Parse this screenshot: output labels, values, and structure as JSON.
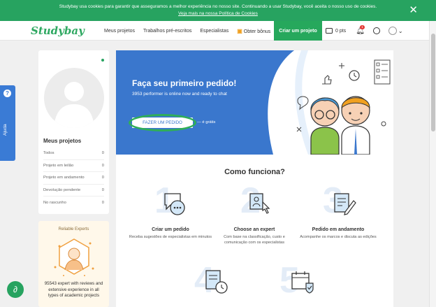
{
  "cookie": {
    "text": "Studybay usa cookies para garantir que asseguramos a melhor experiência no nosso site. Continuando a usar Studybay, você aceita o nosso uso de cookies.",
    "link": "Veja mais na nossa Política de Cookies",
    "close": "✕"
  },
  "header": {
    "logo": "Studybay",
    "nav": [
      "Meus projetos",
      "Trabalhos pré-escritos",
      "Especialistas",
      "Obter bônus"
    ],
    "cta": "Criar um projeto",
    "points": "0 pts",
    "badge": "1"
  },
  "help": {
    "label": "Ajuda",
    "icon": "?"
  },
  "profile": {
    "projects_title": "Meus projetos",
    "items": [
      {
        "label": "Todos",
        "count": "0"
      },
      {
        "label": "Projeto em leilão",
        "count": "0"
      },
      {
        "label": "Projeto em andamento",
        "count": "0"
      },
      {
        "label": "Devolução pendente",
        "count": "0"
      },
      {
        "label": "No rascunho",
        "count": "0"
      }
    ]
  },
  "experts": {
    "title": "Reliable Experts",
    "text": "95543 expert with reviews and extensive experience in all types of academic projects"
  },
  "hero": {
    "title": "Faça seu primeiro pedido!",
    "subtitle": "3953 performer is online now and ready to chat",
    "button": "FAZER UM PEDIDO",
    "free": "— é grátis"
  },
  "how": {
    "title": "Como funciona?",
    "steps": [
      {
        "num": "1",
        "title": "Criar um pedido",
        "desc": "Receba sugestões de especialistas em minutos"
      },
      {
        "num": "2",
        "title": "Choose an expert",
        "desc": "Com base na classificação, custo e comunicação com os especialistas"
      },
      {
        "num": "3",
        "title": "Pedido em andamento",
        "desc": "Acompanhe os marcos e discuta as edições"
      },
      {
        "num": "4"
      },
      {
        "num": "5"
      }
    ]
  },
  "colors": {
    "brand_green": "#27a360",
    "hero_blue": "#3a77cd",
    "help_blue": "#3a7bd5"
  }
}
